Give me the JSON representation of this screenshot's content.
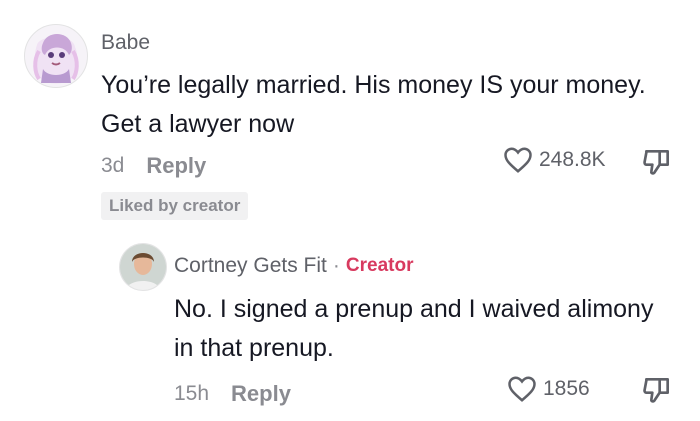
{
  "comments": [
    {
      "username": "Babe",
      "text": "You’re legally married. His money IS your money. Get a lawyer now",
      "age": "3d",
      "reply_label": "Reply",
      "likes": "248.8K",
      "badge": "Liked by creator"
    }
  ],
  "reply_comment": {
    "username": "Cortney Gets Fit",
    "separator": "·",
    "creator_label": "Creator",
    "text": "No. I signed a prenup and I waived alimony in that prenup.",
    "age": "15h",
    "reply_label": "Reply",
    "likes": "1856"
  },
  "colors": {
    "creator_accent": "#d83a5f",
    "muted_text": "#8a8b91"
  },
  "icons": {
    "like": "heart-outline-icon",
    "dislike": "thumbs-down-icon"
  }
}
